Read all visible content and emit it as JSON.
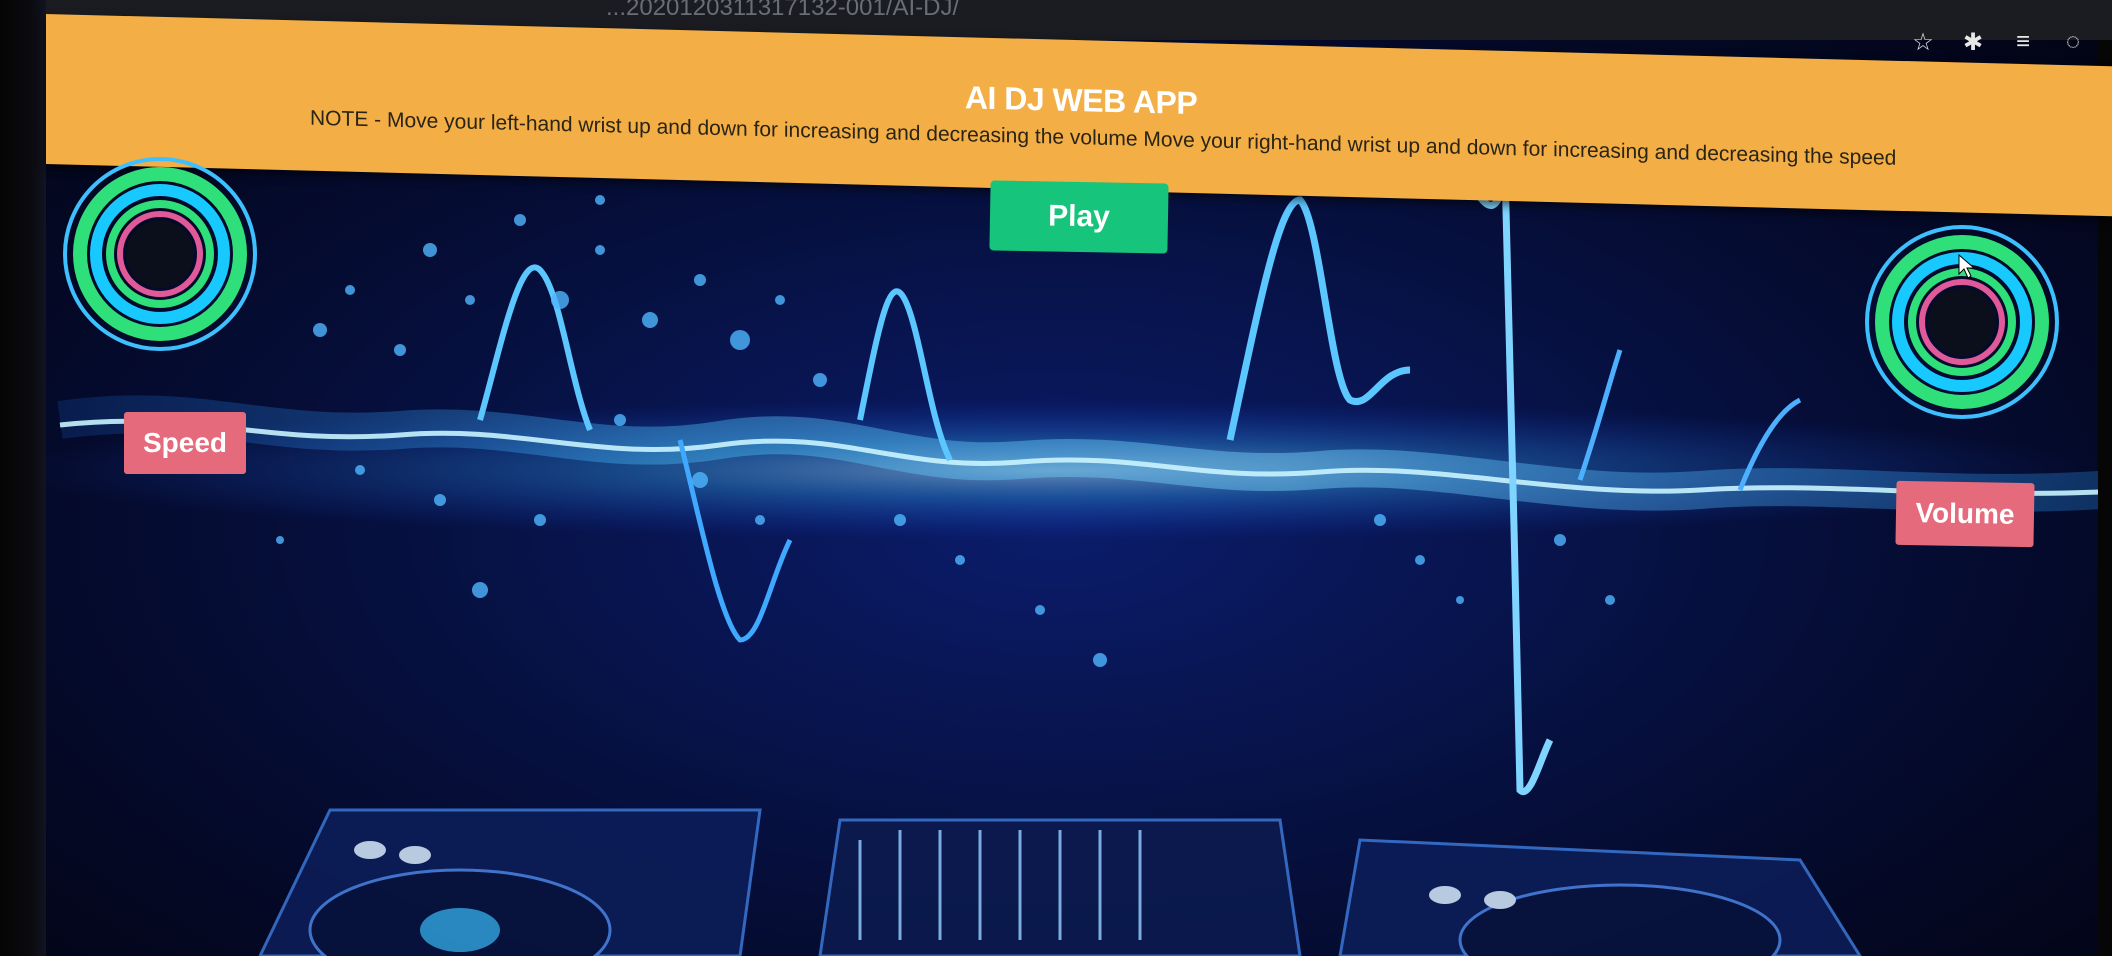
{
  "browser": {
    "url_fragment": "...2020120311317132-001/AI-DJ/",
    "icons": [
      "star-icon",
      "puzzle-extension-icon",
      "playlist-icon",
      "profile-icon"
    ]
  },
  "header": {
    "title": "AI DJ WEB APP",
    "note": "NOTE - Move your left-hand wrist up and down for increasing and decreasing the volume Move your right-hand wrist up and down for increasing and decreasing the speed"
  },
  "controls": {
    "play_label": "Play",
    "speed_label": "Speed",
    "volume_label": "Volume"
  },
  "colors": {
    "header_bg": "#f3ae45",
    "play_bg": "#16c47c",
    "label_bg": "#e46a7c",
    "background": "#06103f",
    "wave": "#3fb8ff"
  }
}
